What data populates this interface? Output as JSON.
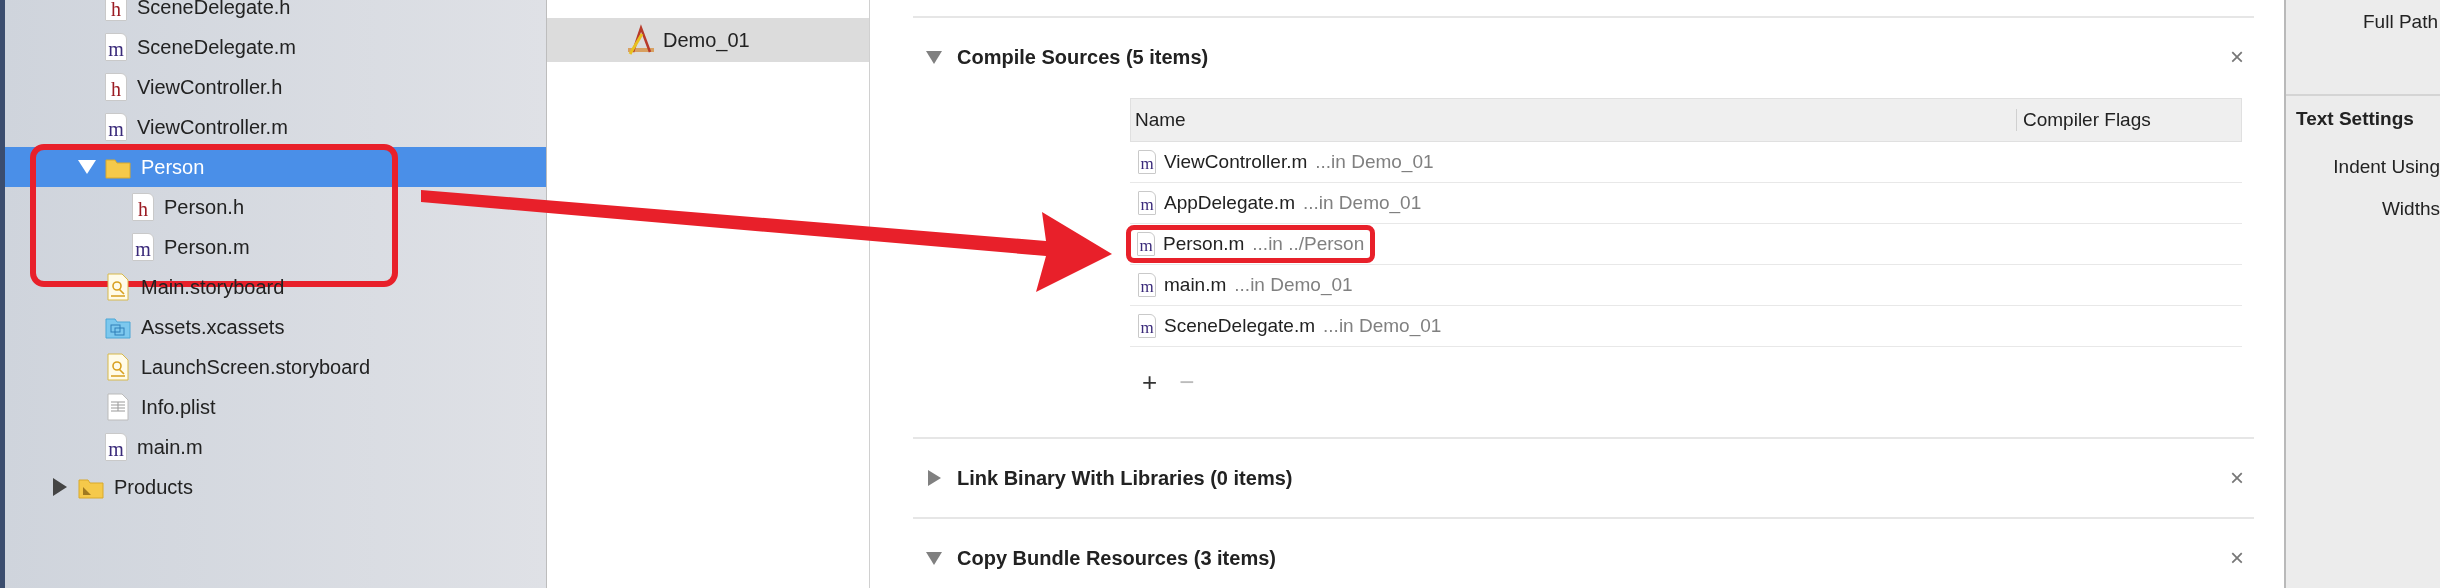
{
  "navigator": {
    "group_items": [
      {
        "name": "SceneDelegate.h",
        "kind": "header",
        "icon_text": "h",
        "selected": false
      },
      {
        "name": "SceneDelegate.m",
        "kind": "source",
        "icon_text": "m",
        "selected": false
      },
      {
        "name": "ViewController.h",
        "kind": "header",
        "icon_text": "h",
        "selected": false
      },
      {
        "name": "ViewController.m",
        "kind": "source",
        "icon_text": "m",
        "selected": false
      },
      {
        "name": "Person",
        "kind": "folder",
        "selected": true,
        "expanded": true,
        "annotated": true,
        "children": [
          {
            "name": "Person.h",
            "kind": "header",
            "icon_text": "h",
            "selected": false
          },
          {
            "name": "Person.m",
            "kind": "source",
            "icon_text": "m",
            "selected": false
          }
        ]
      },
      {
        "name": "Main.storyboard",
        "kind": "storyboard",
        "selected": false
      },
      {
        "name": "Assets.xcassets",
        "kind": "asset-catalog",
        "selected": false
      },
      {
        "name": "LaunchScreen.storyboard",
        "kind": "storyboard",
        "selected": false
      },
      {
        "name": "Info.plist",
        "kind": "plist",
        "selected": false
      },
      {
        "name": "main.m",
        "kind": "source",
        "icon_text": "m",
        "selected": false
      }
    ],
    "root_items": [
      {
        "name": "Products",
        "kind": "products-folder",
        "selected": false,
        "expanded": false
      }
    ]
  },
  "targets": [
    {
      "name": "Demo_01",
      "selected": true
    }
  ],
  "build_phases": [
    {
      "title": "Compile Sources (5 items)",
      "expanded": true,
      "close": "×",
      "table": {
        "columns": [
          "Name",
          "Compiler Flags"
        ],
        "rows": [
          {
            "file": "ViewController.m",
            "icon_text": "m",
            "location": "...in Demo_01",
            "annotated": false
          },
          {
            "file": "AppDelegate.m",
            "icon_text": "m",
            "location": "...in Demo_01",
            "annotated": false
          },
          {
            "file": "Person.m",
            "icon_text": "m",
            "location": "...in ../Person",
            "annotated": true
          },
          {
            "file": "main.m",
            "icon_text": "m",
            "location": "...in Demo_01",
            "annotated": false
          },
          {
            "file": "SceneDelegate.m",
            "icon_text": "m",
            "location": "...in Demo_01",
            "annotated": false
          }
        ],
        "controls": [
          {
            "label": "+",
            "disabled": false
          },
          {
            "label": "−",
            "disabled": true
          }
        ]
      }
    },
    {
      "title": "Link Binary With Libraries (0 items)",
      "expanded": false,
      "close": "×"
    },
    {
      "title": "Copy Bundle Resources (3 items)",
      "expanded": true,
      "close": "×"
    }
  ],
  "inspector": {
    "top_label": "Full Path",
    "section_title": "Text Settings",
    "labels": [
      "Indent Using",
      "Widths"
    ]
  }
}
